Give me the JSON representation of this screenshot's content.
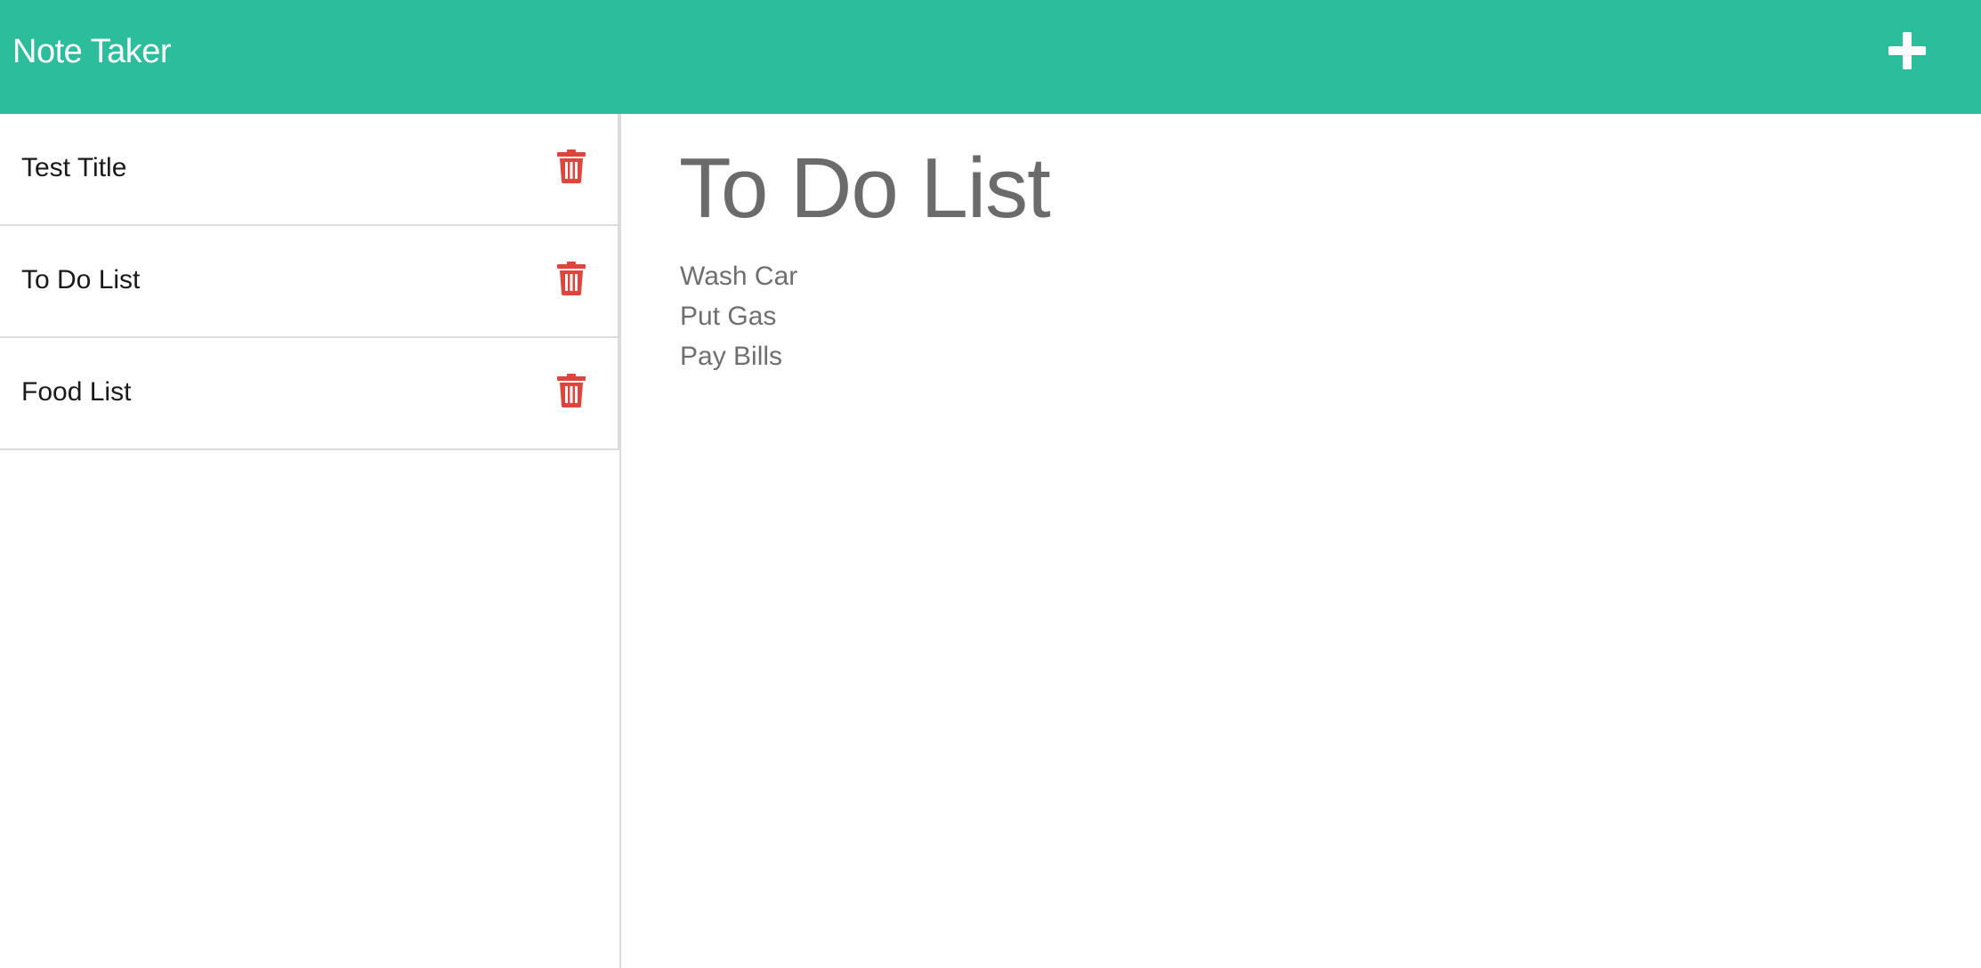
{
  "navbar": {
    "brand": "Note Taker",
    "new_note_icon": "plus-icon",
    "background_color": "#2bbd9c"
  },
  "sidebar": {
    "notes": [
      {
        "title": "Test Title",
        "delete_icon": "trash-icon"
      },
      {
        "title": "To Do List",
        "delete_icon": "trash-icon"
      },
      {
        "title": "Food List",
        "delete_icon": "trash-icon"
      }
    ],
    "delete_icon_color": "#e0453c"
  },
  "main": {
    "note_title": "To Do List",
    "note_body_lines": [
      "Wash Car",
      "Put Gas",
      "Pay Bills"
    ]
  }
}
